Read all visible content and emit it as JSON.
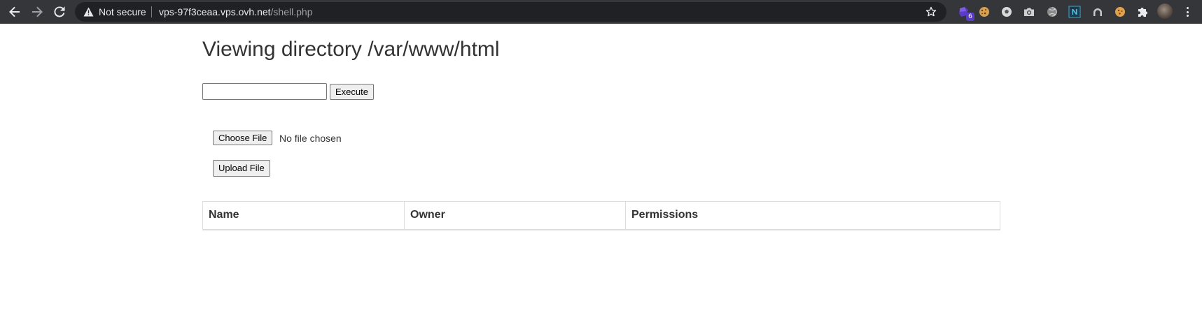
{
  "browser": {
    "security_label": "Not secure",
    "url_host": "vps-97f3ceaa.vps.ovh.net",
    "url_path": "/shell.php",
    "extension_badge_count": "6"
  },
  "page": {
    "title": "Viewing directory /var/www/html",
    "command_input_value": "",
    "execute_label": "Execute",
    "choose_file_label": "Choose File",
    "no_file_text": "No file chosen",
    "upload_label": "Upload File"
  },
  "table": {
    "headers": [
      "Name",
      "Owner",
      "Permissions"
    ],
    "rows": []
  }
}
